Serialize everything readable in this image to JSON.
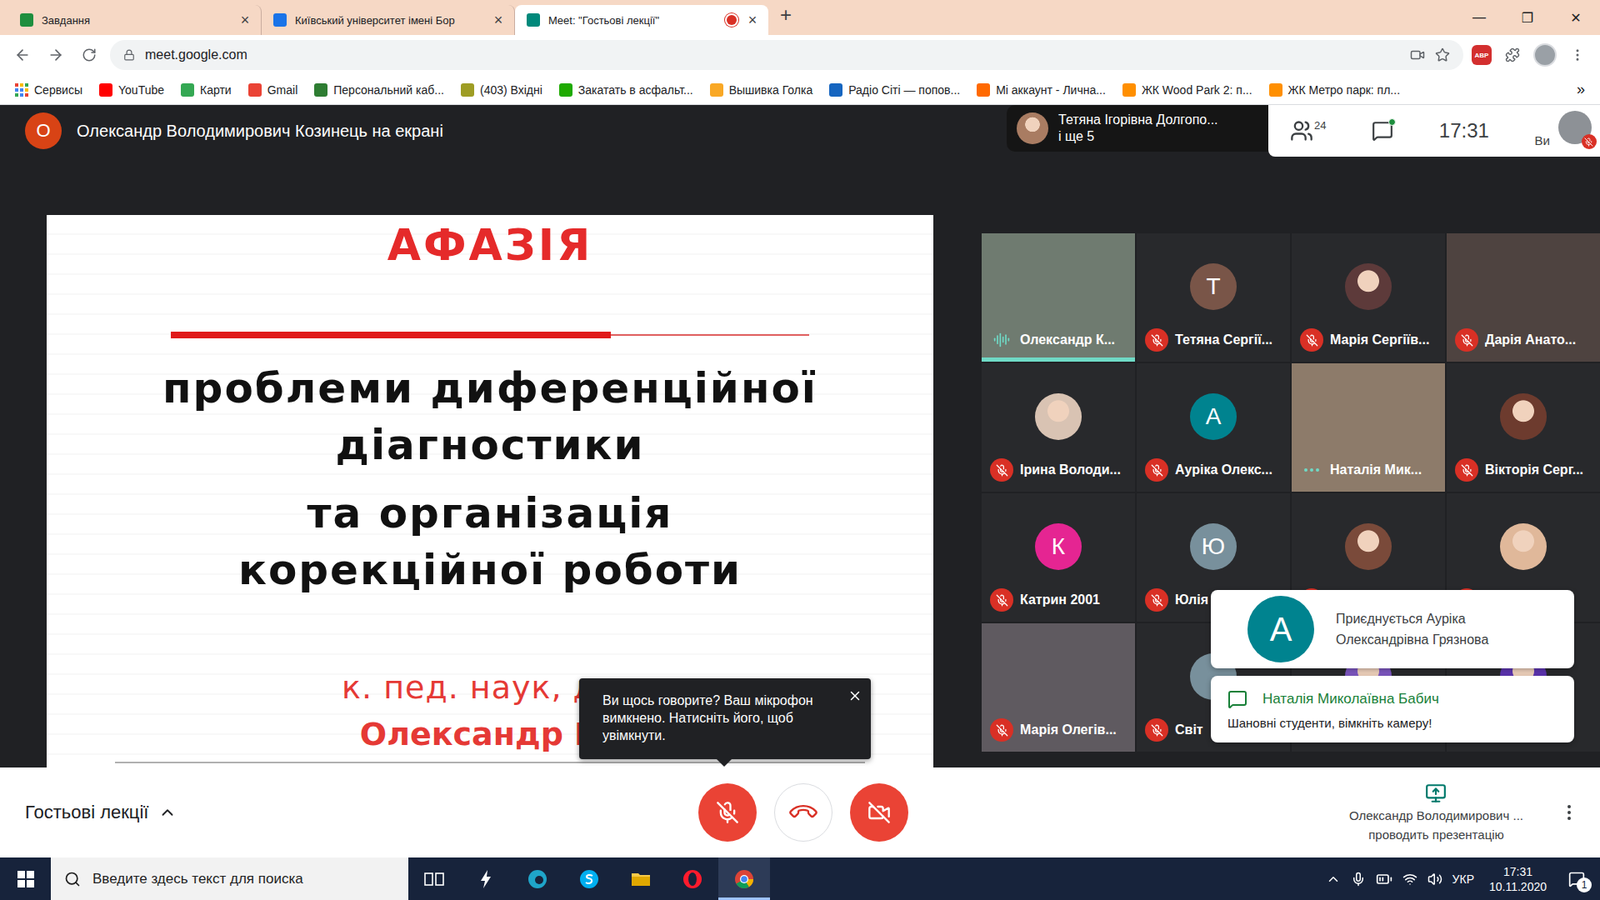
{
  "browser": {
    "tabs": [
      {
        "title": "Завдання",
        "selected": false,
        "recording": false,
        "color": "#1e8e3e"
      },
      {
        "title": "Київський університет імені Бор",
        "selected": false,
        "recording": false,
        "color": "#1a73e8"
      },
      {
        "title": "Meet: \"Гостьові лекції\"",
        "selected": true,
        "recording": true,
        "color": "#00897b"
      }
    ],
    "tab_close": "×",
    "new_tab": "+",
    "window_controls": [
      "—",
      "❐",
      "✕"
    ],
    "address": "meet.google.com",
    "extension_badge": "ABP",
    "bookmarks": [
      {
        "label": "Сервисы",
        "kind": "apps",
        "color": "#4285f4"
      },
      {
        "label": "YouTube",
        "kind": "site",
        "color": "#ff0000"
      },
      {
        "label": "Карти",
        "kind": "site",
        "color": "#34a853"
      },
      {
        "label": "Gmail",
        "kind": "site",
        "color": "#ea4335"
      },
      {
        "label": "Персональний каб...",
        "kind": "site",
        "color": "#2e7d32"
      },
      {
        "label": "(403) Вхідні",
        "kind": "site",
        "color": "#9e9d24"
      },
      {
        "label": "Закатать в асфальт...",
        "kind": "site",
        "color": "#1faa00"
      },
      {
        "label": "Вышивка Голка",
        "kind": "site",
        "color": "#f9a825"
      },
      {
        "label": "Радіо Сіті — попов...",
        "kind": "site",
        "color": "#1565c0"
      },
      {
        "label": "Мі аккаунт - Лична...",
        "kind": "site",
        "color": "#ff6900"
      },
      {
        "label": "ЖК Wood Park 2: п...",
        "kind": "site",
        "color": "#ff8f00"
      },
      {
        "label": "ЖК Метро парк: пл...",
        "kind": "site",
        "color": "#ff8f00"
      }
    ],
    "bookmarks_more": "»"
  },
  "meet": {
    "presenter": {
      "initial": "О",
      "text": "Олександр Володимирович Козинець на екрані"
    },
    "pinned": {
      "name": "Тетяна Ігорівна Долгопо...",
      "more": "і ще 5"
    },
    "people_count": "24",
    "chat_unread": true,
    "time": "17:31",
    "self_label": "Ви",
    "self_muted": true,
    "slide": {
      "title": "АФАЗІЯ",
      "groups": [
        [
          "проблеми диференційної",
          "діагностики"
        ],
        [
          "та організація",
          "корекційної роботи"
        ]
      ],
      "author_degree": "к. пед. наук, доц",
      "author_name": "Олександр Во"
    },
    "participants": [
      {
        "name": "Олександр К...",
        "kind": "video",
        "initial": "",
        "color": "#6f7b70",
        "muted": false,
        "speaking": true
      },
      {
        "name": "Тетяна Сергії...",
        "kind": "letter",
        "initial": "Т",
        "color": "#795548",
        "muted": true,
        "speaking": false
      },
      {
        "name": "Марія Сергіїв...",
        "kind": "photo",
        "initial": "",
        "color": "#5d3a3a",
        "muted": true,
        "speaking": false
      },
      {
        "name": "Дарія Анато...",
        "kind": "video",
        "initial": "",
        "color": "#4e4340",
        "muted": true,
        "speaking": false
      },
      {
        "name": "Ірина Володи...",
        "kind": "photo",
        "initial": "",
        "color": "#d9c3b3",
        "muted": true,
        "speaking": false
      },
      {
        "name": "Ауріка Олекс...",
        "kind": "letter",
        "initial": "А",
        "color": "#00838f",
        "muted": true,
        "speaking": false
      },
      {
        "name": "Наталія Мик...",
        "kind": "video",
        "initial": "",
        "color": "#8d7b6a",
        "muted": false,
        "speaking": false
      },
      {
        "name": "Вікторія Серг...",
        "kind": "photo",
        "initial": "",
        "color": "#6d3b2e",
        "muted": true,
        "speaking": false
      },
      {
        "name": "Катрин 2001",
        "kind": "letter",
        "initial": "К",
        "color": "#e52592",
        "muted": true,
        "speaking": false
      },
      {
        "name": "Юлія",
        "kind": "letter",
        "initial": "Ю",
        "color": "#78909c",
        "muted": true,
        "speaking": false
      },
      {
        "name": "",
        "kind": "photo",
        "initial": "",
        "color": "#7a4a3a",
        "muted": true,
        "speaking": false
      },
      {
        "name": "",
        "kind": "photo",
        "initial": "",
        "color": "#e0b89a",
        "muted": true,
        "speaking": false
      },
      {
        "name": "Марія Олегів...",
        "kind": "video",
        "initial": "",
        "color": "#5f5a60",
        "muted": true,
        "speaking": false
      },
      {
        "name": "Світ",
        "kind": "letter",
        "initial": "",
        "color": "#78909c",
        "muted": true,
        "speaking": false
      },
      {
        "name": "",
        "kind": "photo",
        "initial": "",
        "color": "#7e57c2",
        "muted": true,
        "speaking": false
      },
      {
        "name": "",
        "kind": "photo",
        "initial": "",
        "color": "#5e35b1",
        "muted": true,
        "speaking": false
      }
    ],
    "tooltip": {
      "text": "Ви щось говорите? Ваш мікрофон вимкнено. Натисніть його, щоб увімкнути."
    },
    "notifications": {
      "join": {
        "initial": "А",
        "text": "Приєднується Ауріка Олександрівна Грязнова"
      },
      "chat": {
        "sender": "Наталія Миколаївна Бабич",
        "message": "Шановні студенти, вімкніть камеру!"
      }
    },
    "controls": {
      "meeting_name": "Гостьові лекції",
      "mic_on": false,
      "camera_on": false,
      "presenter_name": "Олександр Володимирович ...",
      "presenting_text": "проводить презентацію"
    }
  },
  "taskbar": {
    "search_placeholder": "Введите здесь текст для поиска",
    "apps": [
      {
        "kind": "taskview",
        "color": "#ffffff",
        "active": false
      },
      {
        "kind": "lightning",
        "color": "#ffffff",
        "active": false
      },
      {
        "kind": "edge",
        "color": "#1fa5c9",
        "active": false
      },
      {
        "kind": "skype",
        "color": "#00aff0",
        "active": false
      },
      {
        "kind": "folder",
        "color": "#f7c948",
        "active": false
      },
      {
        "kind": "opera",
        "color": "#ff1b2d",
        "active": false
      },
      {
        "kind": "chrome",
        "color": "#4285f4",
        "active": true
      }
    ],
    "language": "УКР",
    "time": "17:31",
    "date": "10.11.2020",
    "notifications": "1"
  }
}
